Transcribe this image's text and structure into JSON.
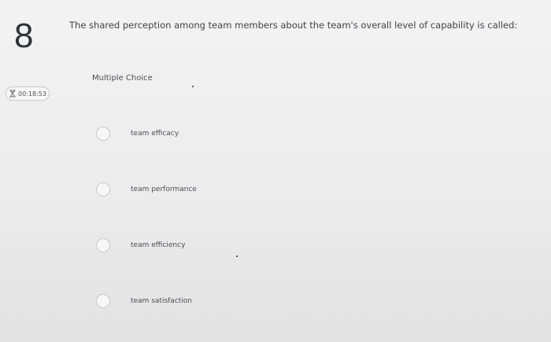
{
  "question": {
    "number": "8",
    "prompt": "The shared perception among team members about the team's overall level of capability is called:",
    "type": "Multiple Choice"
  },
  "timer": {
    "value": "00:18:53",
    "icon": "hourglass-icon"
  },
  "options": [
    {
      "label": "team efficacy",
      "selected": false
    },
    {
      "label": "team performance",
      "selected": false
    },
    {
      "label": "team efficiency",
      "selected": false
    },
    {
      "label": "team satisfaction",
      "selected": false
    }
  ],
  "colors": {
    "background": "#ececec",
    "text": "#3c3f45",
    "radio_border": "#c7c9cd"
  }
}
